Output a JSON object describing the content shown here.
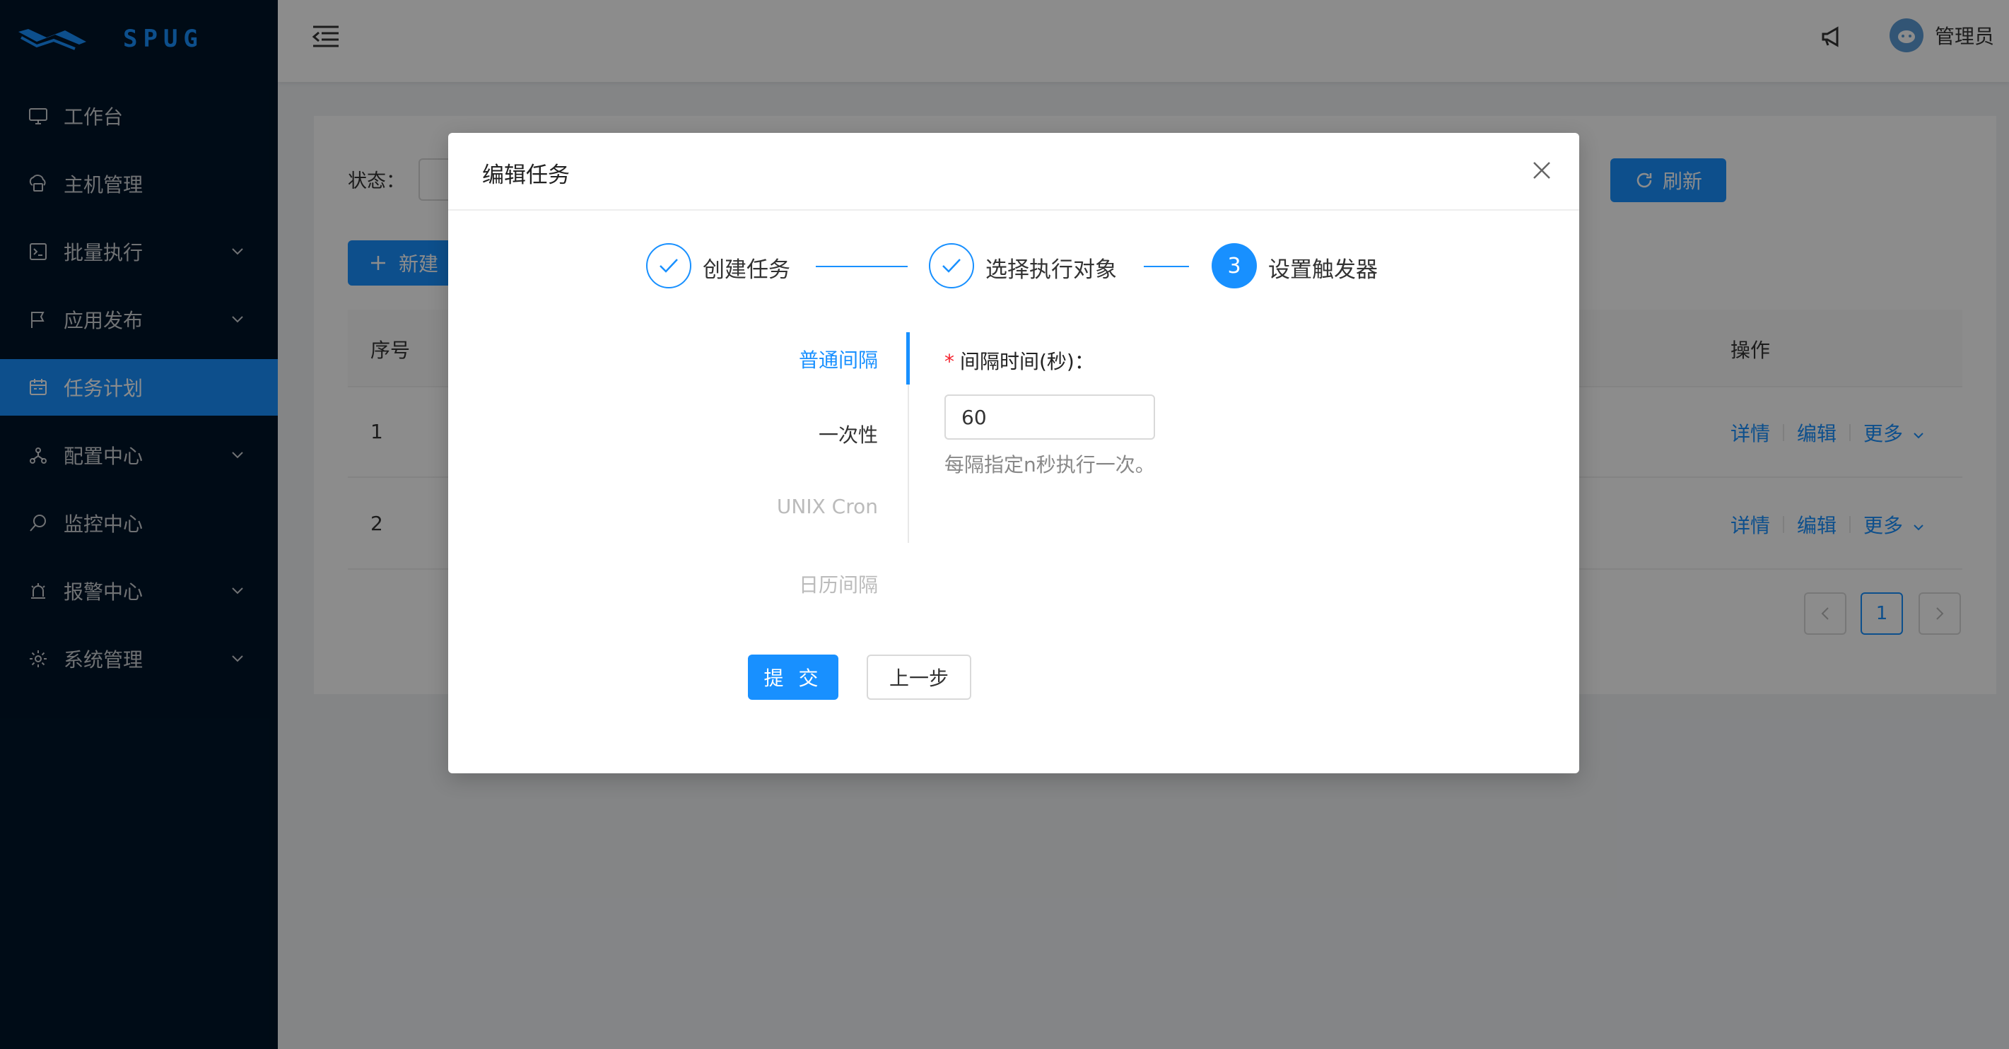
{
  "brand": {
    "name": "SPUG"
  },
  "sidebar": {
    "items": [
      {
        "label": "工作台",
        "icon": "desktop-icon"
      },
      {
        "label": "主机管理",
        "icon": "cloud-server-icon"
      },
      {
        "label": "批量执行",
        "icon": "terminal-icon"
      },
      {
        "label": "应用发布",
        "icon": "flag-icon"
      },
      {
        "label": "任务计划",
        "icon": "schedule-icon",
        "active": true
      },
      {
        "label": "配置中心",
        "icon": "deployment-icon"
      },
      {
        "label": "监控中心",
        "icon": "monitor-icon"
      },
      {
        "label": "报警中心",
        "icon": "alarm-icon"
      },
      {
        "label": "系统管理",
        "icon": "setting-icon"
      }
    ]
  },
  "header": {
    "user": "管理员"
  },
  "page": {
    "status_label": "状态：",
    "new_button": "新建",
    "refresh_button": "刷新",
    "table": {
      "columns": {
        "no": "序号",
        "ops": "操作"
      },
      "rows": [
        {
          "no": "1",
          "detail": "详情",
          "edit": "编辑",
          "more": "更多"
        },
        {
          "no": "2",
          "detail": "详情",
          "edit": "编辑",
          "more": "更多"
        }
      ]
    },
    "pagination": {
      "current": "1"
    }
  },
  "modal": {
    "title": "编辑任务",
    "steps": [
      {
        "label": "创建任务",
        "status": "done"
      },
      {
        "label": "选择执行对象",
        "status": "done"
      },
      {
        "label": "设置触发器",
        "status": "current",
        "number": "3"
      }
    ],
    "tabs": [
      {
        "label": "普通间隔",
        "state": "active"
      },
      {
        "label": "一次性",
        "state": "normal"
      },
      {
        "label": "UNIX Cron",
        "state": "disabled"
      },
      {
        "label": "日历间隔",
        "state": "disabled"
      }
    ],
    "field": {
      "label": "间隔时间(秒)：",
      "value": "60",
      "help": "每隔指定n秒执行一次。"
    },
    "submit_button": "提 交",
    "prev_button": "上一步"
  },
  "colors": {
    "primary": "#1890ff",
    "sider": "#001529"
  }
}
